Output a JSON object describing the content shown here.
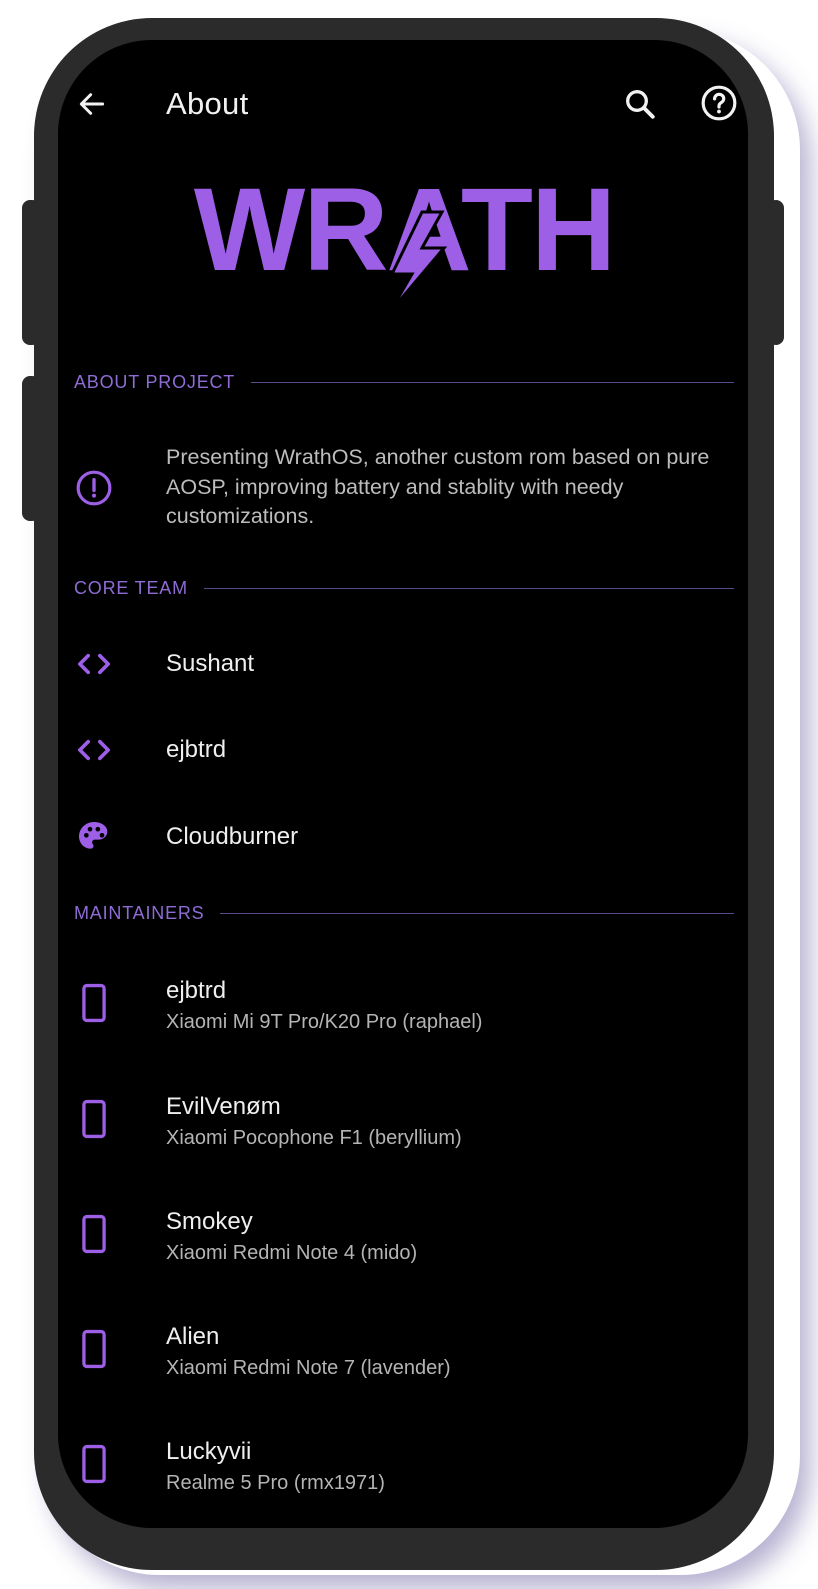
{
  "app": {
    "title": "About",
    "logo_text": "WRATH",
    "accent": "#9c5fe6"
  },
  "appbar_icons": {
    "back": "arrow-left-icon",
    "search": "search-icon",
    "help": "help-circle-icon"
  },
  "about_project": {
    "header": "ABOUT PROJECT",
    "icon": "info-circle-icon",
    "description": "Presenting WrathOS, another custom rom based on pure AOSP, improving battery and stablity with needy customizations."
  },
  "core_team": {
    "header": "CORE TEAM",
    "members": [
      {
        "name": "Sushant",
        "icon": "code-icon"
      },
      {
        "name": "ejbtrd",
        "icon": "code-icon"
      },
      {
        "name": "Cloudburner",
        "icon": "palette-icon"
      }
    ]
  },
  "maintainers": {
    "header": "MAINTAINERS",
    "items": [
      {
        "name": "ejbtrd",
        "device": "Xiaomi Mi 9T Pro/K20 Pro (raphael)",
        "icon": "smartphone-icon"
      },
      {
        "name": "EvilVenøm",
        "device": "Xiaomi Pocophone F1 (beryllium)",
        "icon": "smartphone-icon"
      },
      {
        "name": "Smokey",
        "device": "Xiaomi Redmi Note 4 (mido)",
        "icon": "smartphone-icon"
      },
      {
        "name": "Alien",
        "device": "Xiaomi Redmi Note 7 (lavender)",
        "icon": "smartphone-icon"
      },
      {
        "name": "Luckyvii",
        "device": "Realme 5 Pro (rmx1971)",
        "icon": "smartphone-icon"
      }
    ]
  }
}
